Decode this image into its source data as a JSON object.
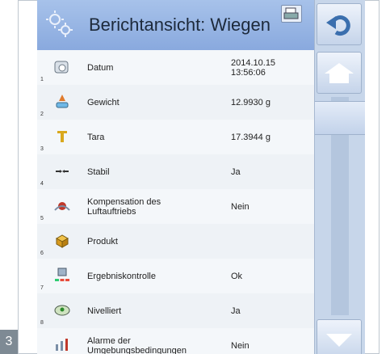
{
  "figure_number": "3",
  "header": {
    "title": "Berichtansicht: Wiegen",
    "icon": "gear-icon",
    "action_icon": "printer-icon"
  },
  "rows": [
    {
      "num": "1",
      "label": "Datum",
      "value": "2014.10.15\n13:56:06",
      "icon": "calendar-icon"
    },
    {
      "num": "2",
      "label": "Gewicht",
      "value": "12.9930 g",
      "icon": "weight-icon"
    },
    {
      "num": "3",
      "label": "Tara",
      "value": "17.3944 g",
      "icon": "tare-icon"
    },
    {
      "num": "4",
      "label": "Stabil",
      "value": "Ja",
      "icon": "stable-icon"
    },
    {
      "num": "5",
      "label": "Kompensation des\nLuftauftriebs",
      "value": "Nein",
      "icon": "air-buoyancy-icon"
    },
    {
      "num": "6",
      "label": "Produkt",
      "value": "",
      "icon": "product-icon"
    },
    {
      "num": "7",
      "label": "Ergebniskontrolle",
      "value": "Ok",
      "icon": "checkweighing-icon"
    },
    {
      "num": "8",
      "label": "Nivelliert",
      "value": "Ja",
      "icon": "level-icon"
    },
    {
      "num": "",
      "label": "Alarme der\nUmgebungsbedingungen",
      "value": "Nein",
      "icon": "alarm-icon"
    }
  ],
  "sidebar": {
    "back_icon": "undo-icon",
    "home_icon": "home-icon",
    "down_icon": "arrow-down-icon"
  }
}
